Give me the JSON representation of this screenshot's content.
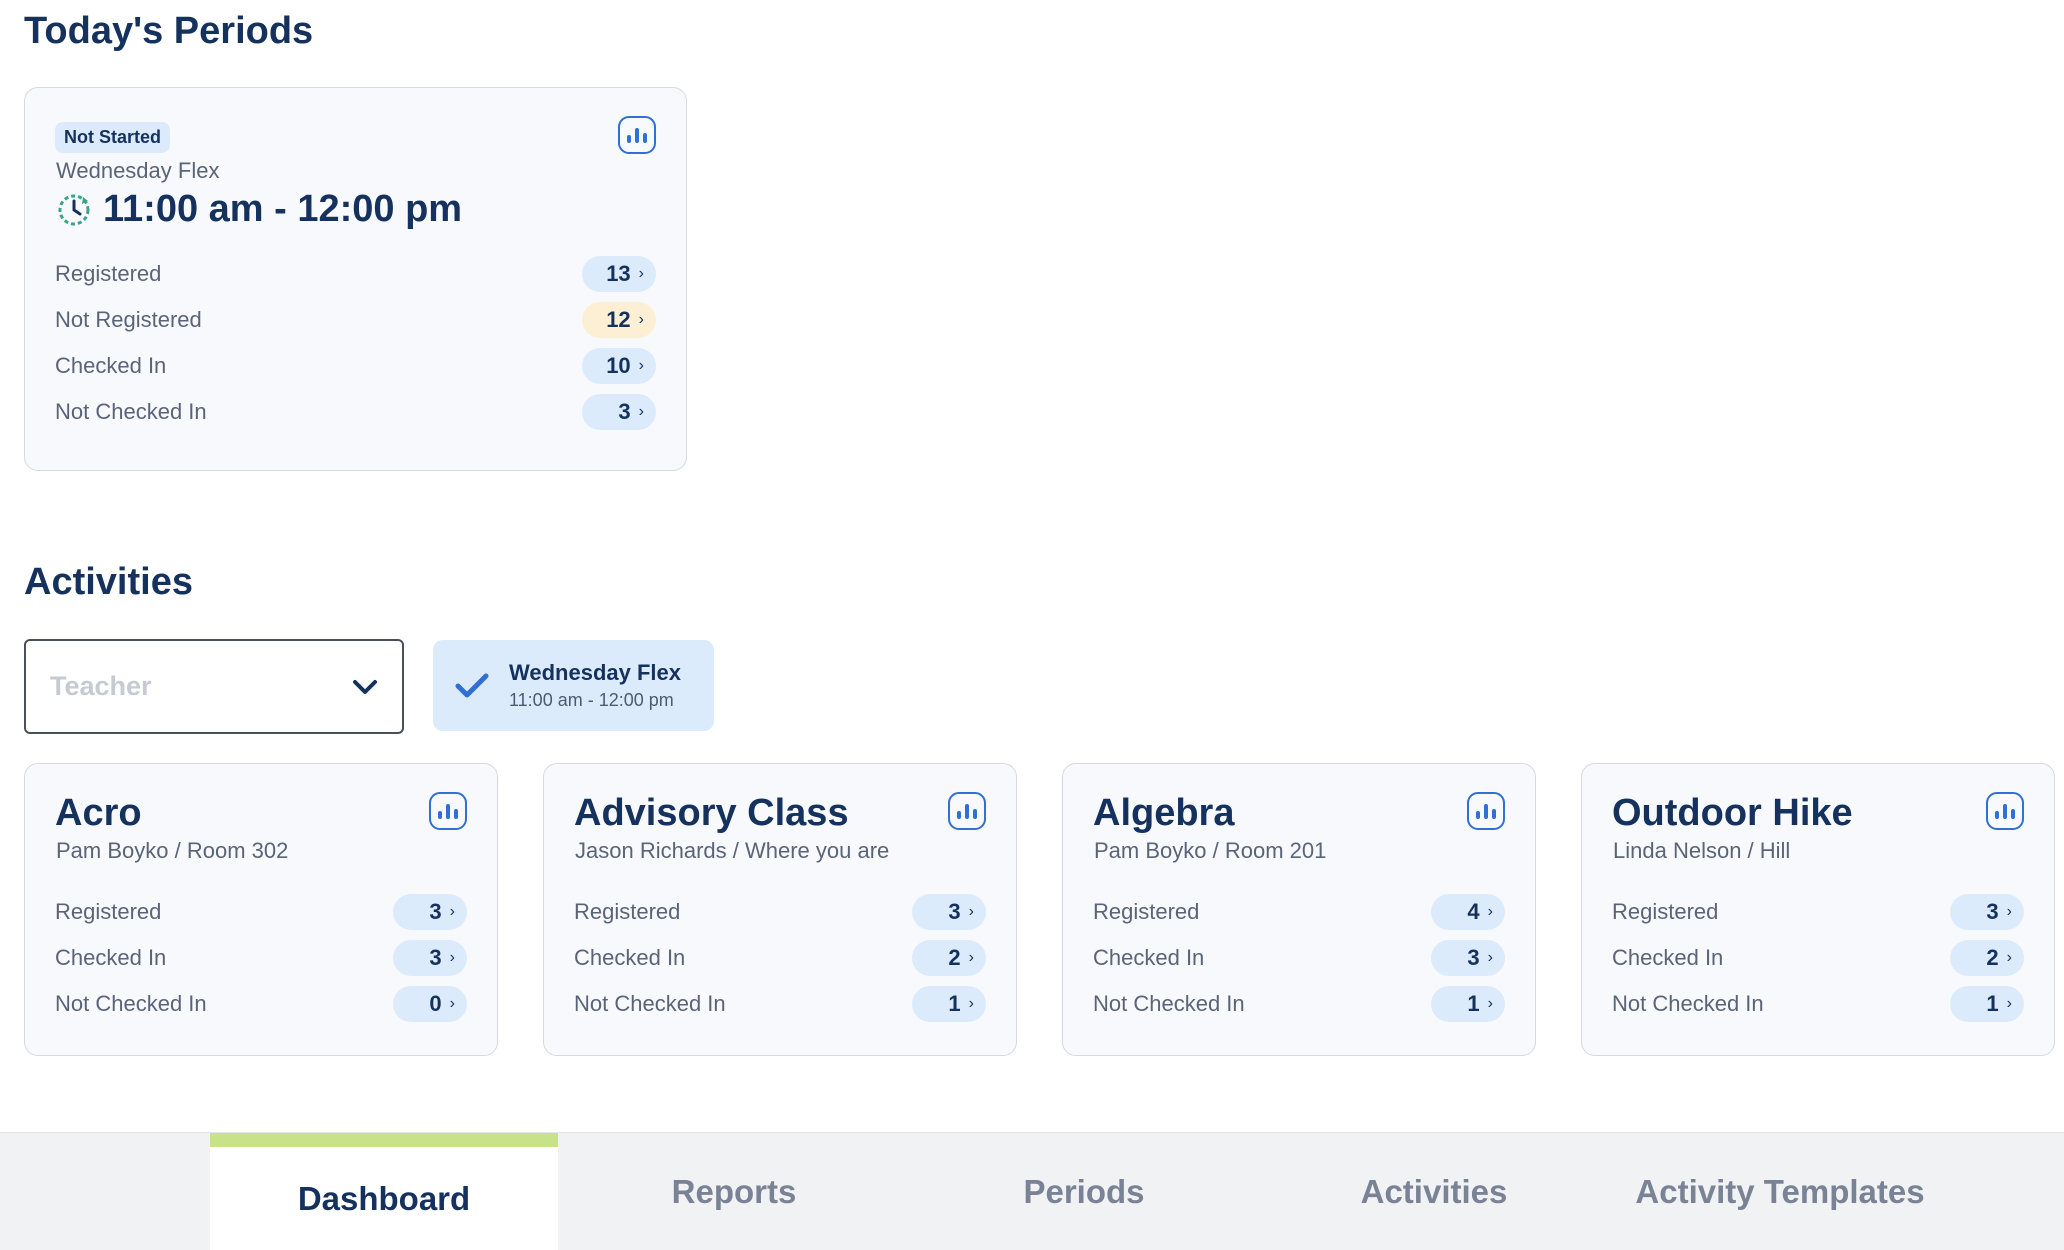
{
  "periods_section": {
    "title": "Today's Periods",
    "card": {
      "status": "Not Started",
      "name": "Wednesday Flex",
      "time": "11:00 am - 12:00 pm",
      "rows": [
        {
          "label": "Registered",
          "value": "13"
        },
        {
          "label": "Not Registered",
          "value": "12"
        },
        {
          "label": "Checked In",
          "value": "10"
        },
        {
          "label": "Not Checked In",
          "value": "3"
        }
      ]
    }
  },
  "activities_section": {
    "title": "Activities",
    "teacher_filter": {
      "placeholder": "Teacher"
    },
    "period_chip": {
      "title": "Wednesday Flex",
      "time": "11:00 am - 12:00 pm"
    },
    "cards": [
      {
        "title": "Acro",
        "subtitle": "Pam Boyko / Room 302",
        "rows": [
          {
            "label": "Registered",
            "value": "3"
          },
          {
            "label": "Checked In",
            "value": "3"
          },
          {
            "label": "Not Checked In",
            "value": "0"
          }
        ]
      },
      {
        "title": "Advisory Class",
        "subtitle": "Jason Richards / Where you are",
        "rows": [
          {
            "label": "Registered",
            "value": "3"
          },
          {
            "label": "Checked In",
            "value": "2"
          },
          {
            "label": "Not Checked In",
            "value": "1"
          }
        ]
      },
      {
        "title": "Algebra",
        "subtitle": "Pam Boyko / Room 201",
        "rows": [
          {
            "label": "Registered",
            "value": "4"
          },
          {
            "label": "Checked In",
            "value": "3"
          },
          {
            "label": "Not Checked In",
            "value": "1"
          }
        ]
      },
      {
        "title": "Outdoor Hike",
        "subtitle": "Linda Nelson / Hill",
        "rows": [
          {
            "label": "Registered",
            "value": "3"
          },
          {
            "label": "Checked In",
            "value": "2"
          },
          {
            "label": "Not Checked In",
            "value": "1"
          }
        ]
      }
    ]
  },
  "bottom_nav": {
    "tabs": [
      {
        "label": "Dashboard",
        "active": true
      },
      {
        "label": "Reports",
        "active": false
      },
      {
        "label": "Periods",
        "active": false
      },
      {
        "label": "Activities",
        "active": false
      },
      {
        "label": "Activity Templates",
        "active": false
      }
    ]
  },
  "colors": {
    "primary_text": "#15315e",
    "pill_blue": "#dcebfc",
    "pill_warning": "#fdefd3",
    "accent": "#2f6fd6",
    "active_tab_bar": "#c8e28a"
  },
  "icons": {
    "stats": "bar-chart-icon",
    "status": "clock-refresh-icon",
    "dropdown": "chevron-down-icon",
    "chip": "check-icon",
    "pill": "chevron-right-icon"
  }
}
